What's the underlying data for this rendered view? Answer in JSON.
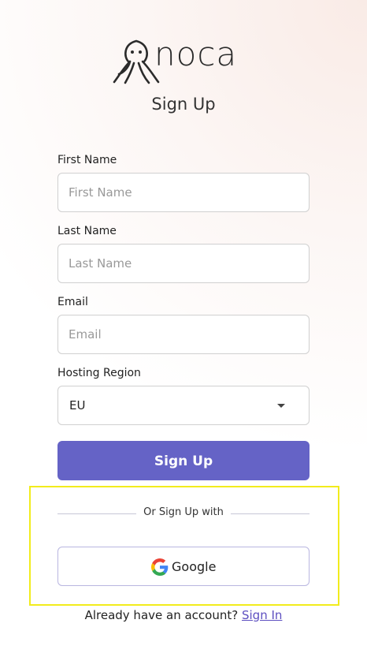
{
  "brand": {
    "name": "noca"
  },
  "page": {
    "title": "Sign Up"
  },
  "form": {
    "first_name": {
      "label": "First Name",
      "placeholder": "First Name",
      "value": ""
    },
    "last_name": {
      "label": "Last Name",
      "placeholder": "Last Name",
      "value": ""
    },
    "email": {
      "label": "Email",
      "placeholder": "Email",
      "value": ""
    },
    "hosting_region": {
      "label": "Hosting Region",
      "selected": "EU"
    },
    "submit_label": "Sign Up"
  },
  "social": {
    "divider_text": "Or Sign Up with",
    "google_label": "Google"
  },
  "footer": {
    "prompt": "Already have an account?",
    "link_label": "Sign In"
  },
  "colors": {
    "primary": "#6563c6",
    "link": "#5d4fc0",
    "highlight": "#f2ec1c"
  }
}
